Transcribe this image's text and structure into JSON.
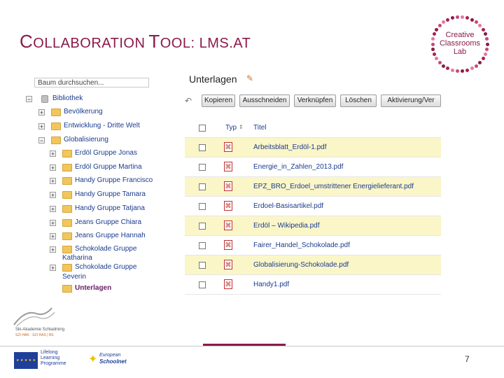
{
  "slide": {
    "title_prefix_1": "C",
    "title_rest_1": "OLLABORATION",
    "title_prefix_2": "T",
    "title_rest_2": "OOL",
    "title_suffix": ": LMS.AT",
    "page_number": "7"
  },
  "brand": {
    "logo_line1": "Creative",
    "logo_line2": "Classrooms",
    "logo_line3": "Lab",
    "accent_color": "#8b1a4a"
  },
  "tree": {
    "search_placeholder": "Baum durchsuchen...",
    "root_label": "Bibliothek",
    "items": [
      {
        "label": "Bevölkerung",
        "toggle": "+"
      },
      {
        "label": "Entwicklung - Dritte Welt",
        "toggle": "+"
      },
      {
        "label": "Globalisierung",
        "toggle": "−"
      }
    ],
    "sub_items": [
      {
        "label": "Erdöl Gruppe Jonas",
        "toggle": "+"
      },
      {
        "label": "Erdöl Gruppe Martina",
        "toggle": "+"
      },
      {
        "label": "Handy Gruppe Francisco",
        "toggle": "+"
      },
      {
        "label": "Handy Gruppe Tamara",
        "toggle": "+"
      },
      {
        "label": "Handy Gruppe Tatjana",
        "toggle": "+"
      },
      {
        "label": "Jeans Gruppe Chiara",
        "toggle": "+"
      },
      {
        "label": "Jeans Gruppe Hannah",
        "toggle": "+"
      },
      {
        "label": "Schokolade Gruppe",
        "label2": "Katharina",
        "toggle": "+"
      },
      {
        "label": "Schokolade Gruppe",
        "label2": "Severin",
        "toggle": "+"
      }
    ],
    "selected_label": "Unterlagen"
  },
  "content": {
    "title": "Unterlagen",
    "toolbar": {
      "copy": "Kopieren",
      "cut": "Ausschneiden",
      "link": "Verknüpfen",
      "delete": "Löschen",
      "activate": "Aktivierung/Ver"
    },
    "columns": {
      "type": "Typ",
      "title": "Titel"
    },
    "files": [
      "Arbeitsblatt_Erdöl-1.pdf",
      "Energie_in_Zahlen_2013.pdf",
      "EPZ_BRO_Erdoel_umstrittener Energielieferant.pdf",
      "Erdoel-Basisartikel.pdf",
      "Erdöl – Wikipedia.pdf",
      "Fairer_Handel_Schokolade.pdf",
      "Globalisierung-Schokolade.pdf",
      "Handy1.pdf"
    ]
  },
  "footer": {
    "sika_name": "Ski-Akademie Schladming",
    "sika_sub": "SZI-HAK · SZI-HAS | BS",
    "llp_line1": "Lifelong",
    "llp_line2": "Learning",
    "llp_line3": "Programme",
    "schoolnet_line1": "European",
    "schoolnet_line2": "Schoolnet"
  }
}
